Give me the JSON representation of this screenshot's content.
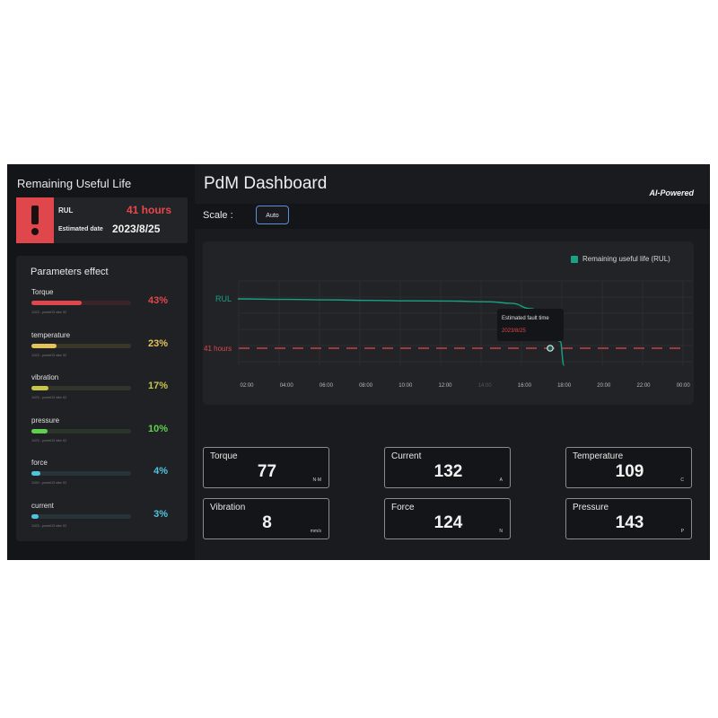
{
  "sidebar": {
    "title": "Remaining Useful Life",
    "rul_label": "RUL",
    "rul_value": "41 hours",
    "estimated_label": "Estimated date",
    "estimated_date": "2023/8/25",
    "params_title": "Parameters effect",
    "params": [
      {
        "name": "Torque",
        "sub": "1103 - panel13 site 02",
        "percent_text": "43%",
        "fill_fraction": 0.5,
        "color": "#e0474c",
        "track": "#3b2427"
      },
      {
        "name": "temperature",
        "sub": "1103 - panel13 site 02",
        "percent_text": "23%",
        "fill_fraction": 0.25,
        "color": "#e3c35a",
        "track": "#3a3627"
      },
      {
        "name": "vibration",
        "sub": "1103 - panel13 site 02",
        "percent_text": "17%",
        "fill_fraction": 0.17,
        "color": "#c6c64a",
        "track": "#34352a"
      },
      {
        "name": "pressure",
        "sub": "1103 - panel13 site 02",
        "percent_text": "10%",
        "fill_fraction": 0.16,
        "color": "#5fd04e",
        "track": "#2a3528"
      },
      {
        "name": "force",
        "sub": "1100 - panel13 site 02",
        "percent_text": "4%",
        "fill_fraction": 0.09,
        "color": "#4fc4de",
        "track": "#243439"
      },
      {
        "name": "current",
        "sub": "1103 - panel13 site 02",
        "percent_text": "3%",
        "fill_fraction": 0.07,
        "color": "#4fc4de",
        "track": "#243439"
      }
    ]
  },
  "header": {
    "title": "PdM Dashboard",
    "badge": "AI-Powered"
  },
  "scale": {
    "label": "Scale :",
    "button": "Auto"
  },
  "chart_data": {
    "type": "line",
    "legend": "Remaining useful life (RUL)",
    "series_label": "RUL",
    "threshold_label": "41 hours",
    "x_ticks": [
      "02:00",
      "04:00",
      "06:00",
      "08:00",
      "10:00",
      "12:00",
      "14:00",
      "16:00",
      "18:00",
      "20:00",
      "22:00",
      "00:00"
    ],
    "series": [
      {
        "name": "Remaining useful life (RUL)",
        "x_hours": [
          1.6,
          4,
          6,
          8,
          10,
          12,
          14,
          15,
          16,
          16.6,
          17,
          17.4,
          17.6
        ],
        "y_norm": [
          1.0,
          0.99,
          0.98,
          0.97,
          0.96,
          0.955,
          0.94,
          0.91,
          0.8,
          0.62,
          0.38,
          0.14,
          -0.35
        ]
      }
    ],
    "threshold_y_norm": 0.0,
    "tooltip": {
      "title": "Estimated fault time",
      "value": "2023/8/25"
    },
    "colors": {
      "line": "#19a185",
      "threshold": "#e0474c"
    }
  },
  "metrics": [
    {
      "label": "Torque",
      "value": "77",
      "unit": "N·M"
    },
    {
      "label": "Current",
      "value": "132",
      "unit": "A"
    },
    {
      "label": "Temperature",
      "value": "109",
      "unit": "C"
    },
    {
      "label": "Vibration",
      "value": "8",
      "unit": "mm/s"
    },
    {
      "label": "Force",
      "value": "124",
      "unit": "N"
    },
    {
      "label": "Pressure",
      "value": "143",
      "unit": "P"
    }
  ]
}
